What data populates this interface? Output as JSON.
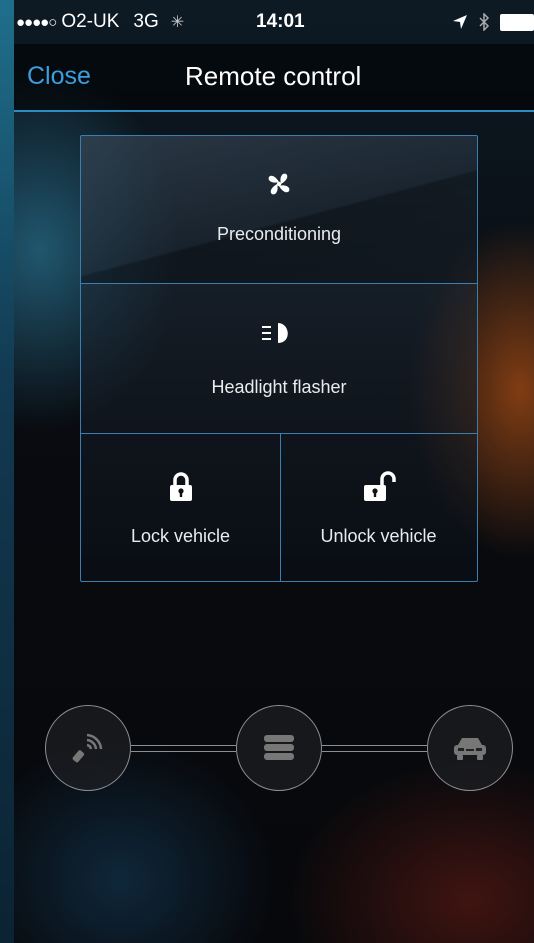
{
  "status_bar": {
    "signal": "●●●●○",
    "carrier": "O2-UK",
    "network": "3G",
    "activity_icon": "activity-spinner-icon",
    "time": "14:01",
    "location_icon": "location-arrow-icon",
    "bluetooth_icon": "bluetooth-icon",
    "battery_icon": "battery-icon"
  },
  "nav": {
    "close_label": "Close",
    "title": "Remote control"
  },
  "controls": {
    "preconditioning": {
      "label": "Preconditioning",
      "icon": "fan-icon"
    },
    "headlight": {
      "label": "Headlight flasher",
      "icon": "headlight-icon"
    },
    "lock": {
      "label": "Lock vehicle",
      "icon": "lock-icon"
    },
    "unlock": {
      "label": "Unlock vehicle",
      "icon": "unlock-icon"
    }
  },
  "connection": {
    "nodes": [
      "remote-signal-icon",
      "server-database-icon",
      "car-icon"
    ]
  },
  "colors": {
    "accent": "#3b9ee0",
    "panel_border": "#3a7fb0",
    "node_border": "#8a8f94"
  }
}
